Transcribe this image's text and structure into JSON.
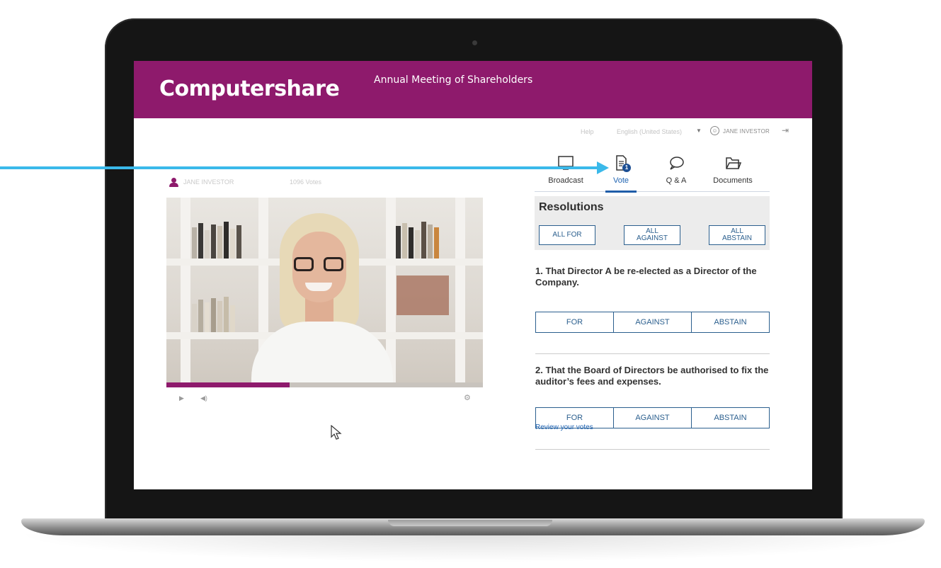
{
  "header": {
    "logo_text": "Computershare",
    "meeting_title": "Annual Meeting of Shareholders",
    "brand_color": "#8e1a6c"
  },
  "topbar": {
    "help": "Help",
    "language": "English (United States)",
    "user_name": "JANE INVESTOR"
  },
  "broadcast": {
    "presenter_name": "JANE INVESTOR",
    "votes_label": "1096 Votes",
    "progress_fraction": 0.39
  },
  "tabs": [
    {
      "label": "Broadcast",
      "icon": "monitor-icon",
      "active": false
    },
    {
      "label": "Vote",
      "icon": "document-icon",
      "active": true,
      "badge": "1"
    },
    {
      "label": "Q & A",
      "icon": "speech-bubble-icon",
      "active": false
    },
    {
      "label": "Documents",
      "icon": "folder-icon",
      "active": false
    }
  ],
  "resolutions": {
    "title": "Resolutions",
    "all_for": "ALL FOR",
    "all_against": "ALL AGAINST",
    "all_abstain": "ALL ABSTAIN",
    "items": [
      {
        "text": "1. That Director A be re-elected as a Director of the Company.",
        "options": [
          "FOR",
          "AGAINST",
          "ABSTAIN"
        ]
      },
      {
        "text": "2. That the Board of Directors be authorised to fix the auditor’s fees and expenses.",
        "options": [
          "FOR",
          "AGAINST",
          "ABSTAIN"
        ]
      }
    ],
    "review_link": "Review your votes"
  },
  "colors": {
    "accent_blue": "#1f5da8",
    "callout_arrow": "#3ab9ea"
  }
}
